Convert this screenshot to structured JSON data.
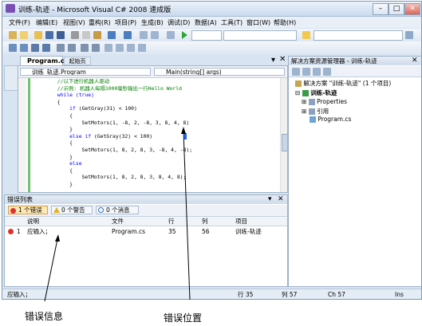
{
  "window": {
    "title": "训练-轨迹 - Microsoft Visual C# 2008 速成版",
    "min_label": "–",
    "max_label": "□",
    "close_label": "✕"
  },
  "menu": [
    "文件(F)",
    "编辑(E)",
    "视图(V)",
    "重构(R)",
    "项目(P)",
    "生成(B)",
    "调试(D)",
    "数据(A)",
    "工具(T)",
    "窗口(W)",
    "帮助(H)"
  ],
  "tabs": {
    "active": "Program.cs",
    "start": "起始页"
  },
  "nav": {
    "class_combo": "训练_轨迹.Program",
    "member_combo": "Main(string[] args)"
  },
  "code": {
    "lines": [
      {
        "type": "com",
        "text": "//以下进行机器人驱动"
      },
      {
        "type": "com",
        "text": "//示例: 机器人每隔1000毫秒输出一行Hello World"
      },
      {
        "type": "kw",
        "text": "while (true)"
      },
      {
        "type": "tx",
        "text": "{"
      },
      {
        "type": "kw2",
        "kw": "if",
        "text": " (GetGray(31) < 100)"
      },
      {
        "type": "tx",
        "text": "    {"
      },
      {
        "type": "tx",
        "text": "        SetMotors(1, -8, 2, -8, 3, 8, 4, 8)"
      },
      {
        "type": "tx",
        "text": "    }"
      },
      {
        "type": "kw2",
        "kw": "else if",
        "text": " (GetGray(32) < 100)"
      },
      {
        "type": "tx",
        "text": "    {"
      },
      {
        "type": "tx",
        "text": "        SetMotors(1, 8, 2, 8, 3, -8, 4, -8);"
      },
      {
        "type": "tx",
        "text": "    }"
      },
      {
        "type": "kw",
        "text": "    else"
      },
      {
        "type": "tx",
        "text": "    {"
      },
      {
        "type": "tx",
        "text": "        SetMotors(1, 8, 2, 8, 3, 8, 4, 8);"
      },
      {
        "type": "tx",
        "text": "    }"
      }
    ]
  },
  "error_list": {
    "title": "错误列表",
    "btn_errors": "1 个错误",
    "btn_warnings": "0 个警告",
    "btn_messages": "0 个消息",
    "columns": {
      "desc": "说明",
      "file": "文件",
      "line": "行",
      "col": "列",
      "project": "项目"
    },
    "rows": [
      {
        "index": "1",
        "desc": "应输入；",
        "file": "Program.cs",
        "line": "35",
        "col": "56",
        "project": "训练-轨迹"
      }
    ]
  },
  "solution": {
    "title": "解决方案资源管理器 - 训练-轨迹",
    "root": "解决方案 \"训练-轨迹\" (1 个项目)",
    "project": "训练-轨迹",
    "items": [
      "Properties",
      "引用",
      "Program.cs"
    ]
  },
  "status": {
    "left": "应输入；",
    "row": "行 35",
    "col": "列 57",
    "ch": "Ch 57",
    "mode": "Ins"
  },
  "annotations": {
    "position": "错误位置",
    "info": "错误信息"
  },
  "colors": {
    "comment": "#008000",
    "keyword": "#0000ff",
    "error_red": "#e03030",
    "accent": "#2060ff"
  }
}
